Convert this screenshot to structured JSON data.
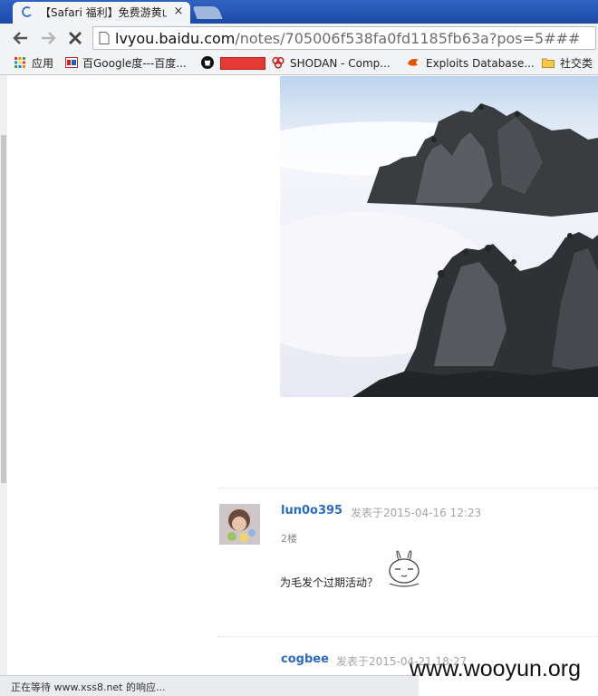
{
  "tab": {
    "title": "【Safari 福利】免费游黄山",
    "close": "×"
  },
  "address_bar": {
    "host": "lvyou.baidu.com",
    "path": "/notes/705006f538fa0fd1185fb63a?pos=5###"
  },
  "bookmarks": [
    {
      "label": "应用",
      "icon": "apps-grid-icon"
    },
    {
      "label": "百Google度---百度...",
      "icon": "baidu-icon"
    },
    {
      "label": "",
      "icon": "github-icon"
    },
    {
      "label": "",
      "icon": "redacted-bookmark"
    },
    {
      "label": "SHODAN - Comp...",
      "icon": "shodan-icon"
    },
    {
      "label": "Exploits Database...",
      "icon": "exploit-db-icon"
    },
    {
      "label": "社交类",
      "icon": "folder-icon"
    }
  ],
  "comments": [
    {
      "user": "lun0o395",
      "time": "发表于2015-04-16 12:23",
      "floor": "2楼",
      "text": "为毛发个过期活动？"
    },
    {
      "user": "cogbee",
      "time": "发表于2015-04-21 18:27"
    }
  ],
  "status": {
    "text": "正在等待 www.xss8.net 的响应..."
  },
  "watermark": "www.wooyun.org",
  "colors": {
    "tab_strip": "#2f63c2",
    "username": "#2a6cbf",
    "timestamp": "#a6a6a6"
  }
}
